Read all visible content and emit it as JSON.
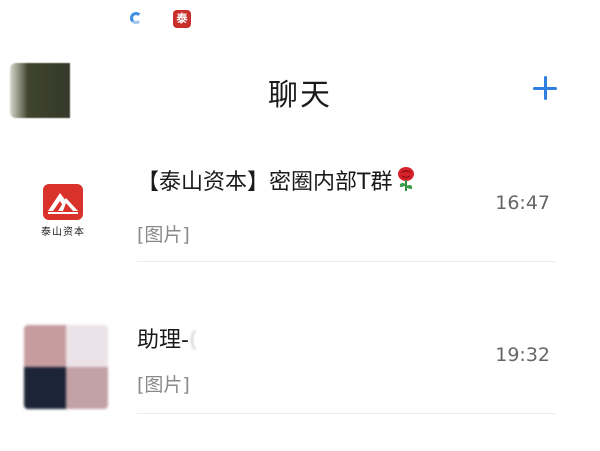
{
  "status_bar": {
    "icons": [
      "loading-spinner-icon",
      "app-notification-icon"
    ],
    "app_icon_glyph": "泰"
  },
  "header": {
    "title": "聊天",
    "add_icon": "plus-icon",
    "accent_color": "#2f7fe0"
  },
  "chats": [
    {
      "avatar": "taishan-logo-avatar",
      "avatar_caption": "泰山资本",
      "name": "【泰山资本】密圈内部T群",
      "name_emoji": "rose-icon",
      "preview": "[图片]",
      "time": "16:47"
    },
    {
      "avatar": "blurred-photo-avatar",
      "name": "助理-",
      "name_fade": "(",
      "preview": "[图片]",
      "time": "19:32"
    }
  ]
}
